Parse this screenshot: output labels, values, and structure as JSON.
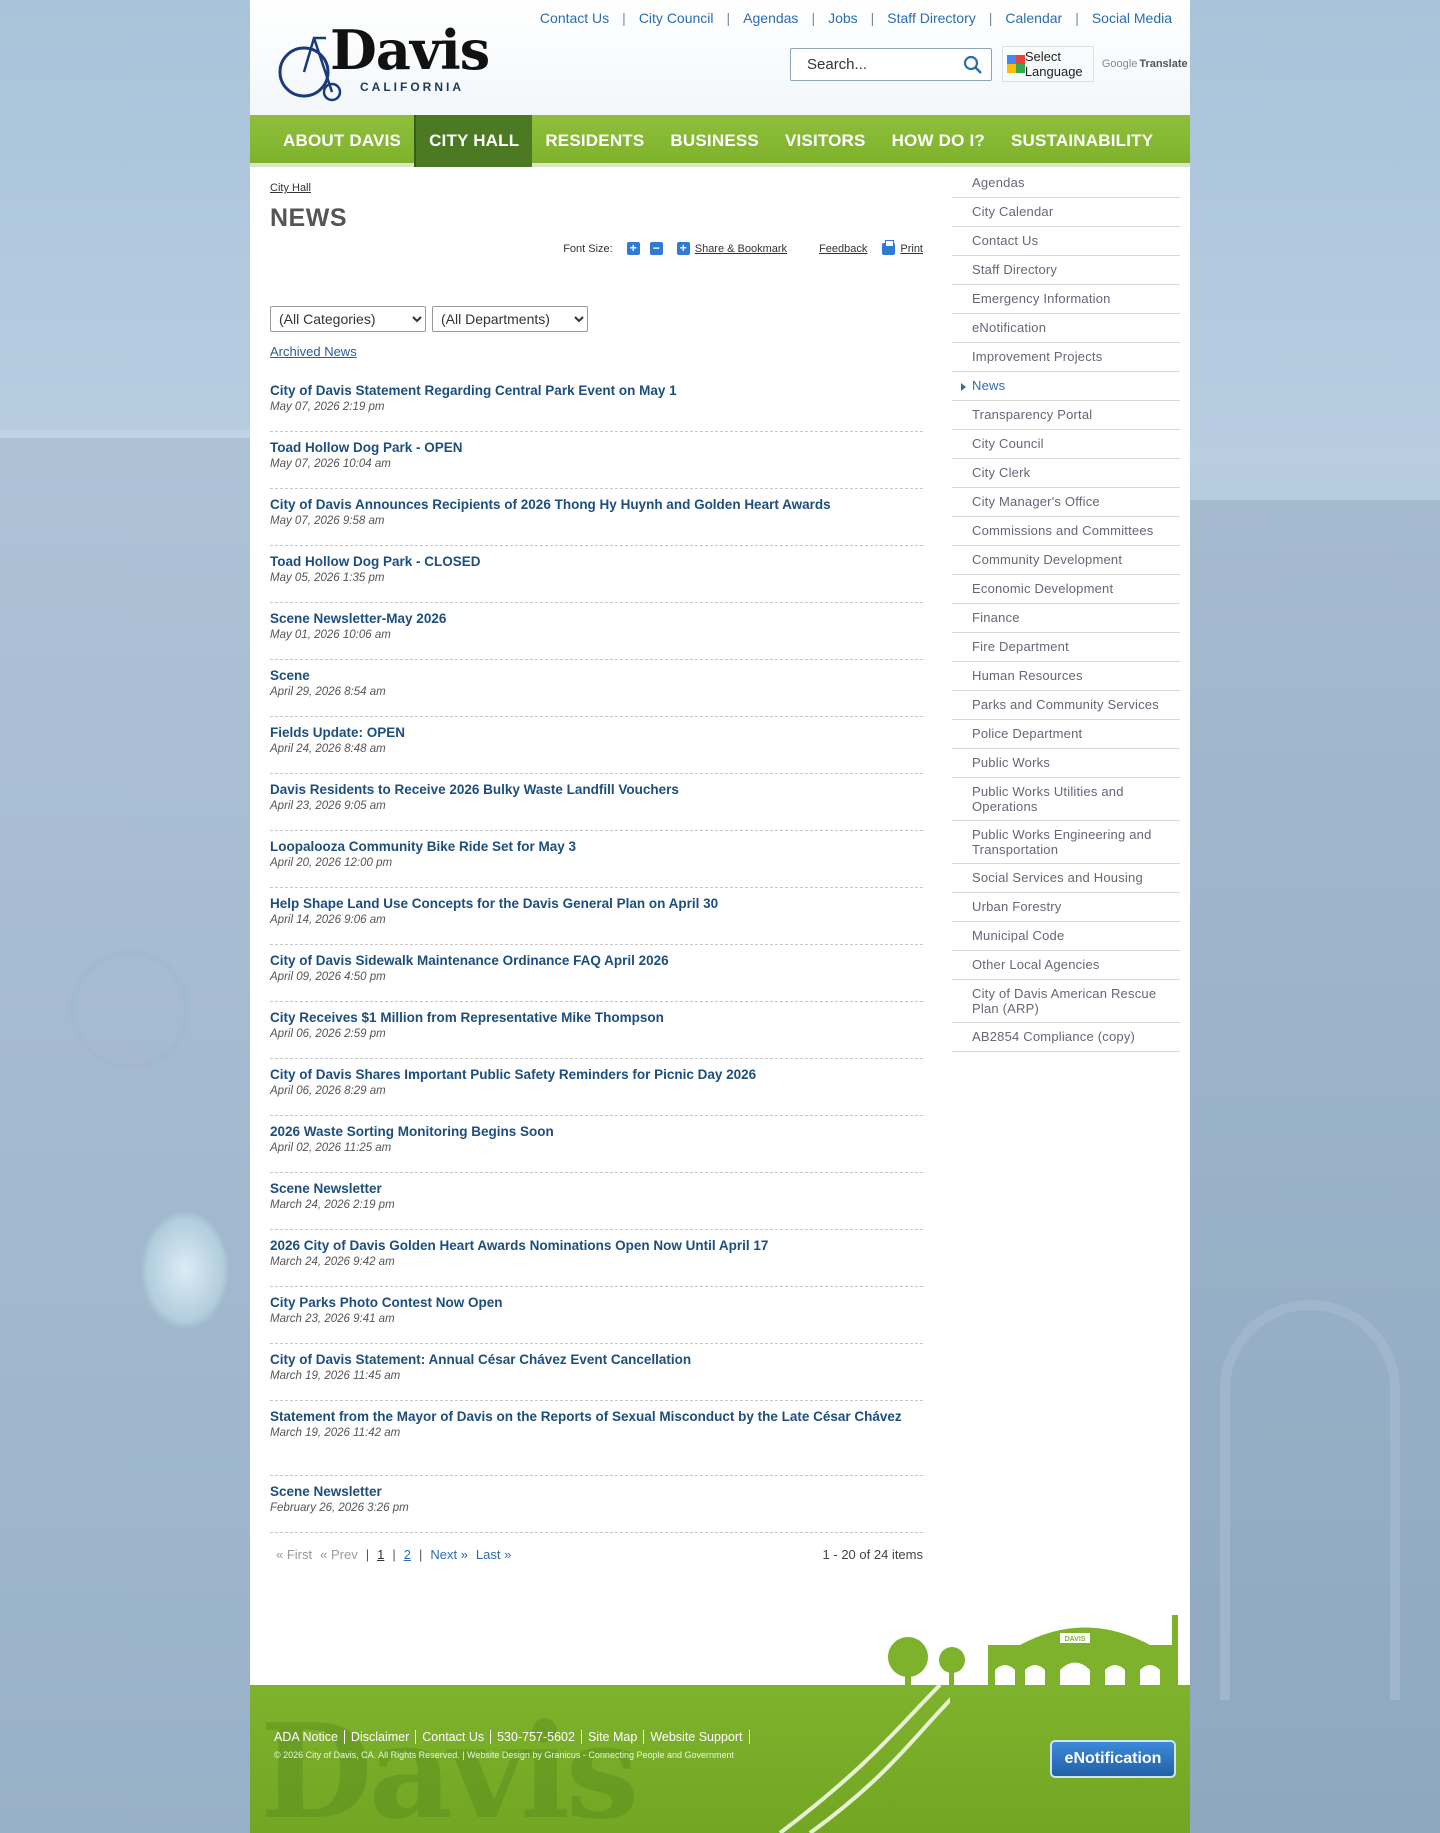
{
  "header": {
    "logo_word": "Davis",
    "logo_sub": "CALIFORNIA",
    "utility_nav": [
      "Contact Us",
      "City Council",
      "Agendas",
      "Jobs",
      "Staff Directory",
      "Calendar",
      "Social Media"
    ],
    "search": {
      "placeholder": "Search..."
    },
    "translate": {
      "label": "Select Language",
      "powered": "Google",
      "action": "Translate"
    }
  },
  "nav": {
    "items": [
      "ABOUT DAVIS",
      "CITY HALL",
      "RESIDENTS",
      "BUSINESS",
      "VISITORS",
      "HOW DO I?",
      "SUSTAINABILITY"
    ],
    "active": "CITY HALL"
  },
  "breadcrumb": "City Hall",
  "title": "NEWS",
  "tools": {
    "font_size_label": "Font Size:",
    "plus": "+",
    "minus": "−",
    "share": "Share & Bookmark",
    "feedback": "Feedback",
    "print": "Print"
  },
  "filters": {
    "categories": "(All Categories)",
    "departments": "(All Departments)"
  },
  "archived": "Archived News",
  "news": [
    {
      "title": "City of Davis Statement Regarding Central Park Event on May 1",
      "date": "May 07, 2026 2:19 pm"
    },
    {
      "title": "Toad Hollow Dog Park - OPEN",
      "date": "May 07, 2026 10:04 am"
    },
    {
      "title": "City of Davis Announces Recipients of 2026 Thong Hy Huynh and Golden Heart Awards",
      "date": "May 07, 2026 9:58 am"
    },
    {
      "title": "Toad Hollow Dog Park - CLOSED",
      "date": "May 05, 2026 1:35 pm"
    },
    {
      "title": "Scene Newsletter-May 2026",
      "date": "May 01, 2026 10:06 am"
    },
    {
      "title": "Scene",
      "date": "April 29, 2026 8:54 am"
    },
    {
      "title": "Fields Update: OPEN",
      "date": "April 24, 2026 8:48 am"
    },
    {
      "title": "Davis Residents to Receive 2026 Bulky Waste Landfill Vouchers",
      "date": "April 23, 2026 9:05 am"
    },
    {
      "title": "Loopalooza Community Bike Ride Set for May 3",
      "date": "April 20, 2026 12:00 pm"
    },
    {
      "title": "Help Shape Land Use Concepts for the Davis General Plan on April 30",
      "date": "April 14, 2026 9:06 am"
    },
    {
      "title": "City of Davis Sidewalk Maintenance Ordinance FAQ April 2026",
      "date": "April 09, 2026 4:50 pm"
    },
    {
      "title": "City Receives $1 Million from Representative Mike Thompson",
      "date": "April 06, 2026 2:59 pm"
    },
    {
      "title": "City of Davis Shares Important Public Safety Reminders for Picnic Day 2026",
      "date": "April 06, 2026 8:29 am"
    },
    {
      "title": "2026 Waste Sorting Monitoring Begins Soon",
      "date": "April 02, 2026 11:25 am"
    },
    {
      "title": "Scene Newsletter",
      "date": "March 24, 2026 2:19 pm"
    },
    {
      "title": "2026 City of Davis Golden Heart Awards Nominations Open Now Until April 17",
      "date": "March 24, 2026 9:42 am"
    },
    {
      "title": "City Parks Photo Contest Now Open",
      "date": "March 23, 2026 9:41 am"
    },
    {
      "title": "City of Davis Statement: Annual César Chávez Event Cancellation",
      "date": "March 19, 2026 11:45 am"
    },
    {
      "title": "Statement from the Mayor of Davis on the Reports of Sexual Misconduct by the Late César Chávez",
      "date": "March 19, 2026 11:42 am"
    },
    {
      "title": "Scene Newsletter",
      "date": "February 26, 2026 3:26 pm"
    }
  ],
  "pager": {
    "first": "« First",
    "prev": "« Prev",
    "sep": "|",
    "page1": "1",
    "page2": "2",
    "next": "Next »",
    "last": "Last »",
    "count": "1 - 20 of 24 items"
  },
  "sidebar": {
    "items": [
      "Agendas",
      "City Calendar",
      "Contact Us",
      "Staff Directory",
      "Emergency Information",
      "eNotification",
      "Improvement Projects",
      "News",
      "Transparency Portal",
      "City Council",
      "City Clerk",
      "City Manager's Office",
      "Commissions and Committees",
      "Community Development",
      "Economic Development",
      "Finance",
      "Fire Department",
      "Human Resources",
      "Parks and Community Services",
      "Police Department",
      "Public Works",
      "Public Works Utilities and Operations",
      "Public Works Engineering and Transportation",
      "Social Services and Housing",
      "Urban Forestry",
      "Municipal Code",
      "Other Local Agencies",
      "City of Davis American Rescue Plan (ARP)",
      "AB2854 Compliance (copy)"
    ],
    "active": "News"
  },
  "footer": {
    "links": [
      "ADA Notice",
      "Disclaimer",
      "Contact Us",
      "530-757-5602",
      "Site Map",
      "Website Support"
    ],
    "copyright": "© 2026 City of Davis, CA. All Rights Reserved. | Website Design by Granicus - Connecting People and Government",
    "enotification": "eNotification",
    "watermark": "Davis",
    "building_sign": "DAVIS",
    "social": [
      "facebook-icon",
      "nextdoor-icon",
      "x-icon"
    ]
  },
  "colors": {
    "nav_green": "#7fb22c",
    "nav_active": "#4b7a22",
    "link_blue": "#2a6db1",
    "news_title": "#1d4e7e"
  }
}
